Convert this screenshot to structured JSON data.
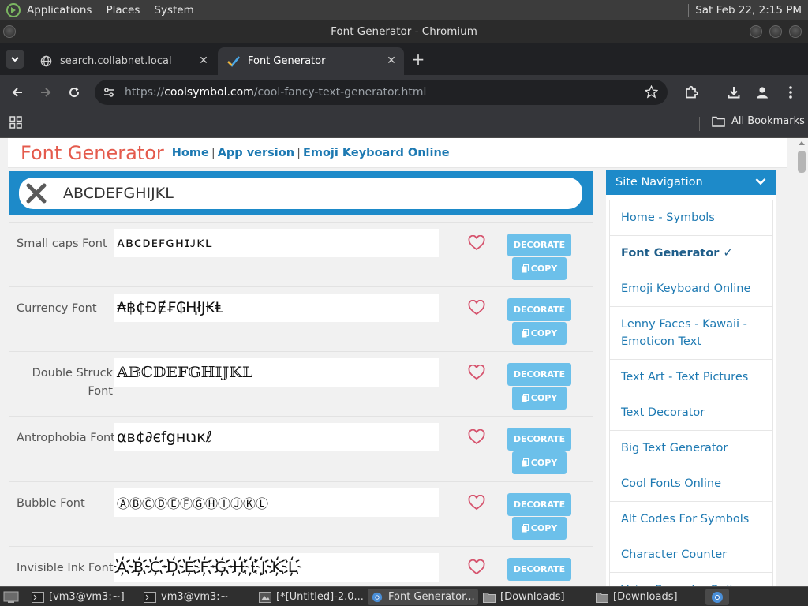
{
  "os_panel": {
    "menus": [
      "Applications",
      "Places",
      "System"
    ],
    "clock": "Sat Feb 22,  2:15 PM"
  },
  "window": {
    "title": "Font Generator - Chromium"
  },
  "tabs": [
    {
      "title": "search.collabnet.local",
      "favicon": "globe-icon"
    },
    {
      "title": "Font Generator",
      "favicon": "checkmark-icon",
      "active": true
    }
  ],
  "address_bar": {
    "scheme": "https://",
    "host": "coolsymbol.com",
    "path": "/cool-fancy-text-generator.html"
  },
  "bookmarks": {
    "all_label": "All Bookmarks"
  },
  "site": {
    "logo": "Font Generator",
    "links": [
      "Home",
      "App version",
      "Emoji Keyboard Online"
    ],
    "separator": "|"
  },
  "search": {
    "value": "ABCDEFGHIJKL"
  },
  "buttons": {
    "decorate": "DECORATE",
    "copy": "COPY"
  },
  "fonts": [
    {
      "name": "Small caps Font",
      "sample": "ᴀʙᴄᴅᴇꜰɢʜɪᴊᴋʟ"
    },
    {
      "name": "Currency Font",
      "sample": "₳฿₵ĐɆ₣₲ⱧłJ₭Ⱡ"
    },
    {
      "name": "Double Struck Font",
      "sample": "𝔸𝔹ℂ𝔻𝔼𝔽𝔾ℍ𝕀𝕁𝕂𝕃"
    },
    {
      "name": "Antrophobia Font",
      "sample": "αв¢∂єfgнιנкℓ"
    },
    {
      "name": "Bubble Font",
      "sample": "ⒶⒷⒸⒹⒺⒻⒼⒽⒾⒿⓀⓁ"
    },
    {
      "name": "Invisible Ink Font",
      "sample": "A҉B҉C҉D҉E҉F҉G҉H҉I҉J҉K҉L҉"
    }
  ],
  "side_nav": {
    "title": "Site Navigation",
    "items": [
      "Home - Symbols",
      "Font Generator ✓",
      "Emoji Keyboard Online",
      "Lenny Faces - Kawaii - Emoticon Text",
      "Text Art - Text Pictures",
      "Text Decorator",
      "Big Text Generator",
      "Cool Fonts Online",
      "Alt Codes For Symbols",
      "Character Counter",
      "Voice Recorder Online"
    ],
    "current_index": 1
  },
  "taskbar": {
    "items": [
      {
        "label": "[vm3@vm3:~]",
        "icon": "terminal-icon"
      },
      {
        "label": "vm3@vm3:~",
        "icon": "terminal-icon"
      },
      {
        "label": "[*[Untitled]-2.0...",
        "icon": "image-editor-icon"
      },
      {
        "label": "Font Generator...",
        "icon": "chromium-icon",
        "active": true
      },
      {
        "label": "[Downloads]",
        "icon": "folder-icon"
      },
      {
        "label": "[Downloads]",
        "icon": "folder-icon"
      }
    ]
  },
  "colors": {
    "brand_red": "#e45a4c",
    "link_blue": "#1d79b2",
    "header_blue": "#1d8ac9",
    "button_blue": "#6cc0ea",
    "heart": "#d6546e"
  }
}
